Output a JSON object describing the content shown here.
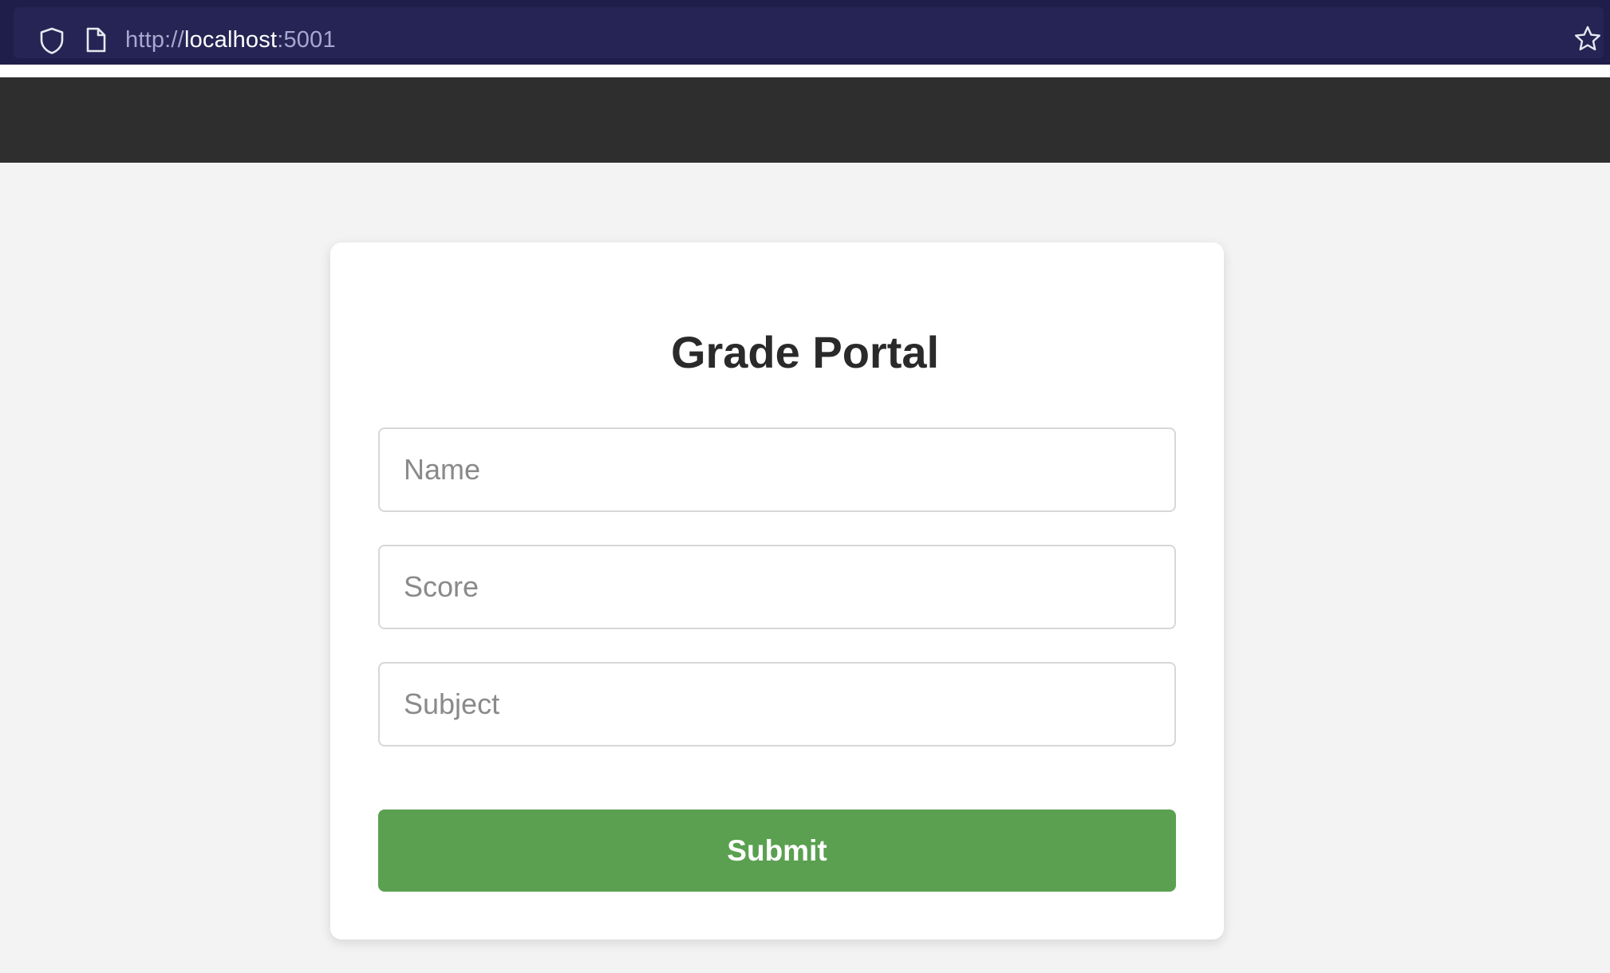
{
  "browser": {
    "url_scheme": "http://",
    "url_host": "localhost",
    "url_port": ":5001",
    "icons": [
      "shield-icon",
      "page-icon",
      "star-icon"
    ]
  },
  "page": {
    "title": "Grade Portal"
  },
  "form": {
    "name_placeholder": "Name",
    "score_placeholder": "Score",
    "subject_placeholder": "Subject",
    "submit_label": "Submit"
  },
  "colors": {
    "browser_bar": "#1f1d4a",
    "navbar": "#2e2e2e",
    "background": "#f3f3f3",
    "submit_button": "#5aa050"
  }
}
